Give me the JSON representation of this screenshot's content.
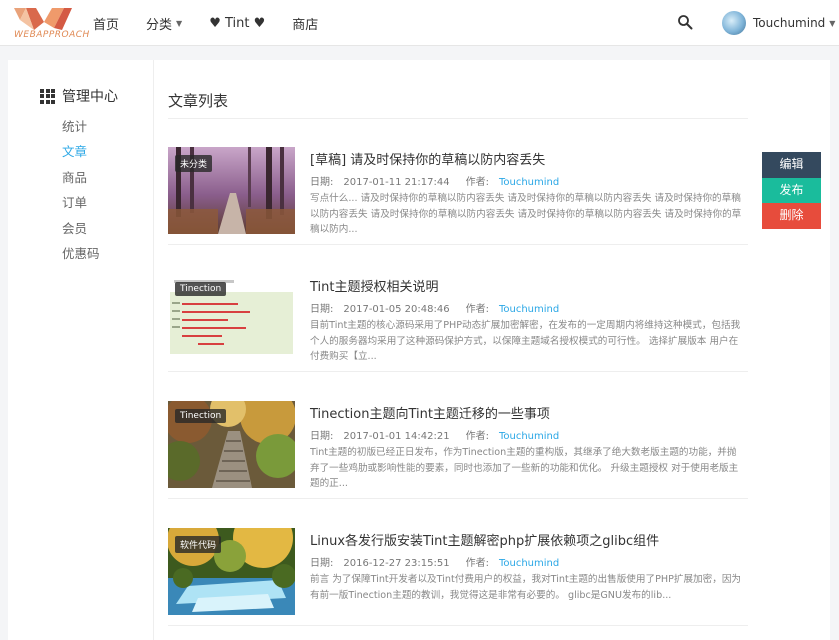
{
  "header": {
    "logo_text": "WEBAPPROACH",
    "nav": [
      {
        "label": "首页",
        "has_caret": false
      },
      {
        "label": "分类",
        "has_caret": true
      },
      {
        "label": "♥ Tint ♥",
        "has_caret": false
      },
      {
        "label": "商店",
        "has_caret": false
      }
    ],
    "search_icon": "search-icon",
    "user_name": "Touchumind"
  },
  "sidebar": {
    "title": "管理中心",
    "title_icon": "grid-icon",
    "items": [
      {
        "label": "统计",
        "active": false
      },
      {
        "label": "文章",
        "active": true
      },
      {
        "label": "商品",
        "active": false
      },
      {
        "label": "订单",
        "active": false
      },
      {
        "label": "会员",
        "active": false
      },
      {
        "label": "优惠码",
        "active": false
      }
    ]
  },
  "content": {
    "title": "文章列表",
    "date_label": "日期:",
    "author_label": "作者:",
    "posts": [
      {
        "tag": "未分类",
        "title": "[草稿] 请及时保持你的草稿以防内容丢失",
        "date": "2017-01-11 21:17:44",
        "author": "Touchumind",
        "excerpt": "写点什么... 请及时保持你的草稿以防内容丢失 请及时保持你的草稿以防内容丢失 请及时保持你的草稿以防内容丢失 请及时保持你的草稿以防内容丢失 请及时保持你的草稿以防内容丢失 请及时保持你的草稿以防内..."
      },
      {
        "tag": "Tinection",
        "title": "Tint主题授权相关说明",
        "date": "2017-01-05 20:48:46",
        "author": "Touchumind",
        "excerpt": "目前Tint主题的核心源码采用了PHP动态扩展加密解密，在发布的一定周期内将维持这种模式，包括我个人的服务器均采用了这种源码保护方式，以保障主题域名授权模式的可行性。 选择扩展版本 用户在付费购买【立..."
      },
      {
        "tag": "Tinection",
        "title": "Tinection主题向Tint主题迁移的一些事项",
        "date": "2017-01-01 14:42:21",
        "author": "Touchumind",
        "excerpt": "Tint主题的初版已经正日发布，作为Tinection主题的重构版，其继承了绝大数老版主题的功能，并抛弃了一些鸡肋或影响性能的要素，同时也添加了一些新的功能和优化。 升级主题授权 对于使用老版主题的正..."
      },
      {
        "tag": "软件代码",
        "title": "Linux各发行版安装Tint主题解密php扩展依赖项之glibc组件",
        "date": "2016-12-27 23:15:51",
        "author": "Touchumind",
        "excerpt": "前言 为了保障Tint开发者以及Tint付费用户的权益，我对Tint主题的出售版使用了PHP扩展加密，因为有前一版Tinection主题的教训，我觉得这是非常有必要的。 glibc是GNU发布的lib..."
      }
    ]
  },
  "actions": {
    "edit": "编辑",
    "publish": "发布",
    "delete": "删除"
  },
  "colors": {
    "accent": "#2aa7e6",
    "edit": "#34495e",
    "publish": "#1abc9c",
    "delete": "#e74c3c"
  }
}
